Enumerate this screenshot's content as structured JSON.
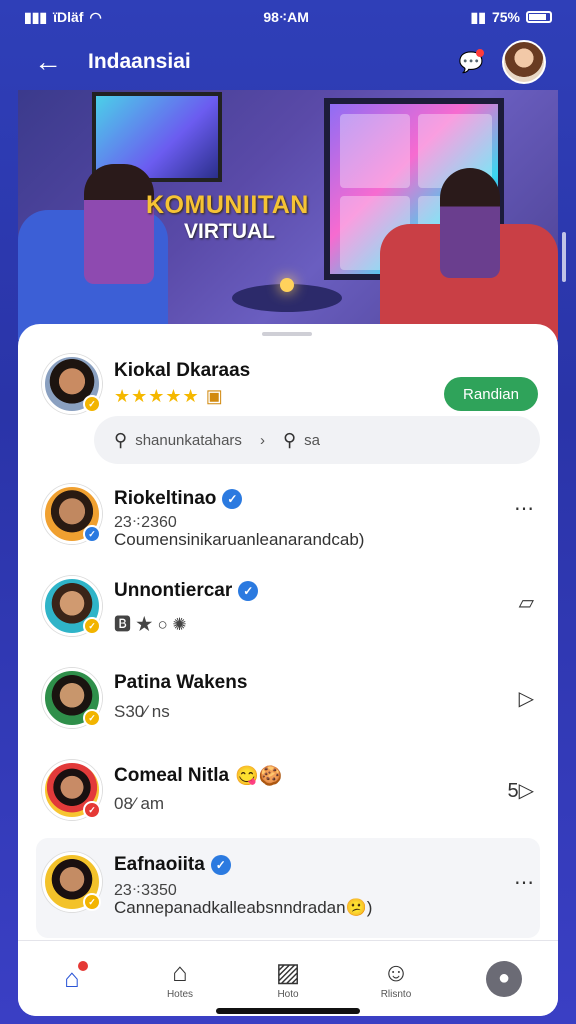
{
  "status_bar": {
    "left_text": "ϊDläf",
    "time": "98⁖AM",
    "right_text": "75%"
  },
  "app_bar": {
    "title": "Indaansiai",
    "back_icon": "arrow-left-icon",
    "notification_icon": "chat-bubble-icon"
  },
  "hero": {
    "title": "KOMUNIITAN",
    "subtitle": "VIRTUAL"
  },
  "profile": {
    "name": "Kiokal Dkaraas",
    "stars": "★★★★★",
    "chest": "▣",
    "follow_label": "Randian"
  },
  "search": {
    "left_text": "shanunkatahars",
    "separator": "›",
    "right_text": "sa"
  },
  "chats": [
    {
      "name": "Riokeltinao",
      "sub": "23⁖2360",
      "message": "Coumensinikaruanleanarandcab)",
      "action_icon": "more-dots-icon",
      "action_glyph": "⋯"
    },
    {
      "name": "Unnontiercar",
      "sub": "🅱 ★ ○ ✺",
      "action_icon": "square-icon",
      "action_glyph": "▱"
    },
    {
      "name": "Patina Wakens",
      "sub": "S30⁄ ns",
      "action_icon": "video-icon",
      "action_glyph": "▷"
    },
    {
      "name": "Comeal Nitla",
      "sub": "08⁄ am",
      "action_icon": "video-icon",
      "action_glyph": "5▷"
    },
    {
      "name": "Eafnaoiita",
      "sub": "23⁖3350",
      "message": "Cannepanadkalleabsnndradan😕)",
      "action_icon": "more-dots-icon",
      "action_glyph": "⋯"
    }
  ],
  "nav": {
    "home_label": "",
    "discover_label": "Hotes",
    "notes_label": "Hoto",
    "status_label": "Rlisnto"
  },
  "colors": {
    "accent": "#2a55d6",
    "follow_green": "#2fa35a",
    "background": "#2f3fb8"
  }
}
